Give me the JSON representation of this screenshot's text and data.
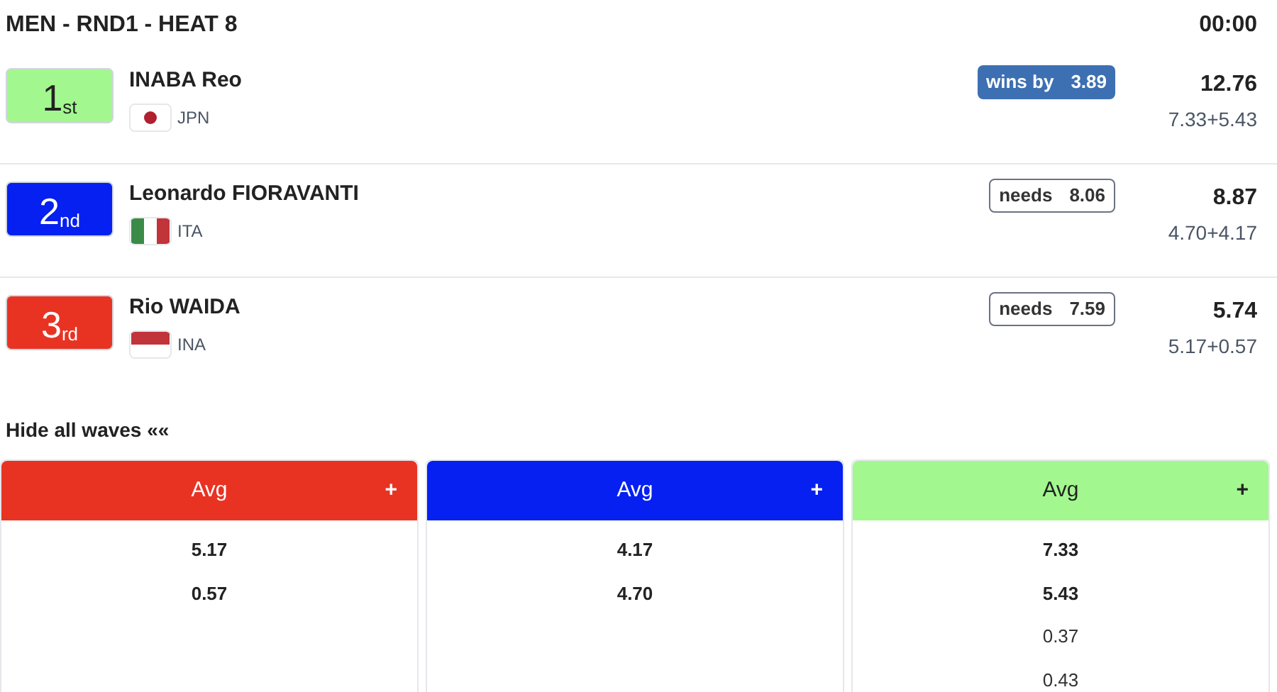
{
  "heat": {
    "title": "MEN - RND1 - HEAT 8",
    "clock": "00:00"
  },
  "athletes": [
    {
      "rank": "1",
      "suffix": "st",
      "color": "#a3f78f",
      "name": "INABA Reo",
      "country": "JPN",
      "badge": {
        "kind": "wins",
        "label": "wins by",
        "value": "3.89"
      },
      "total": "12.76",
      "breakdown": "7.33+5.43"
    },
    {
      "rank": "2",
      "suffix": "nd",
      "color": "#0520f0",
      "name": "Leonardo FIORAVANTI",
      "country": "ITA",
      "badge": {
        "kind": "needs",
        "label": "needs",
        "value": "8.06"
      },
      "total": "8.87",
      "breakdown": "4.70+4.17"
    },
    {
      "rank": "3",
      "suffix": "rd",
      "color": "#e83323",
      "name": "Rio WAIDA",
      "country": "INA",
      "badge": {
        "kind": "needs",
        "label": "needs",
        "value": "7.59"
      },
      "total": "5.74",
      "breakdown": "5.17+0.57"
    }
  ],
  "waves_toggle": "Hide all waves ««",
  "columns": [
    {
      "color": "#e83323",
      "header": "Avg",
      "expand": "+",
      "waves": [
        {
          "score": "5.17",
          "counted": true
        },
        {
          "score": "0.57",
          "counted": true
        }
      ]
    },
    {
      "color": "#0520f0",
      "header": "Avg",
      "expand": "+",
      "waves": [
        {
          "score": "4.17",
          "counted": true
        },
        {
          "score": "4.70",
          "counted": true
        }
      ]
    },
    {
      "color": "#a3f78f",
      "header": "Avg",
      "expand": "+",
      "waves": [
        {
          "score": "7.33",
          "counted": true
        },
        {
          "score": "5.43",
          "counted": true
        },
        {
          "score": "0.37",
          "counted": false
        },
        {
          "score": "0.43",
          "counted": false
        }
      ]
    }
  ]
}
